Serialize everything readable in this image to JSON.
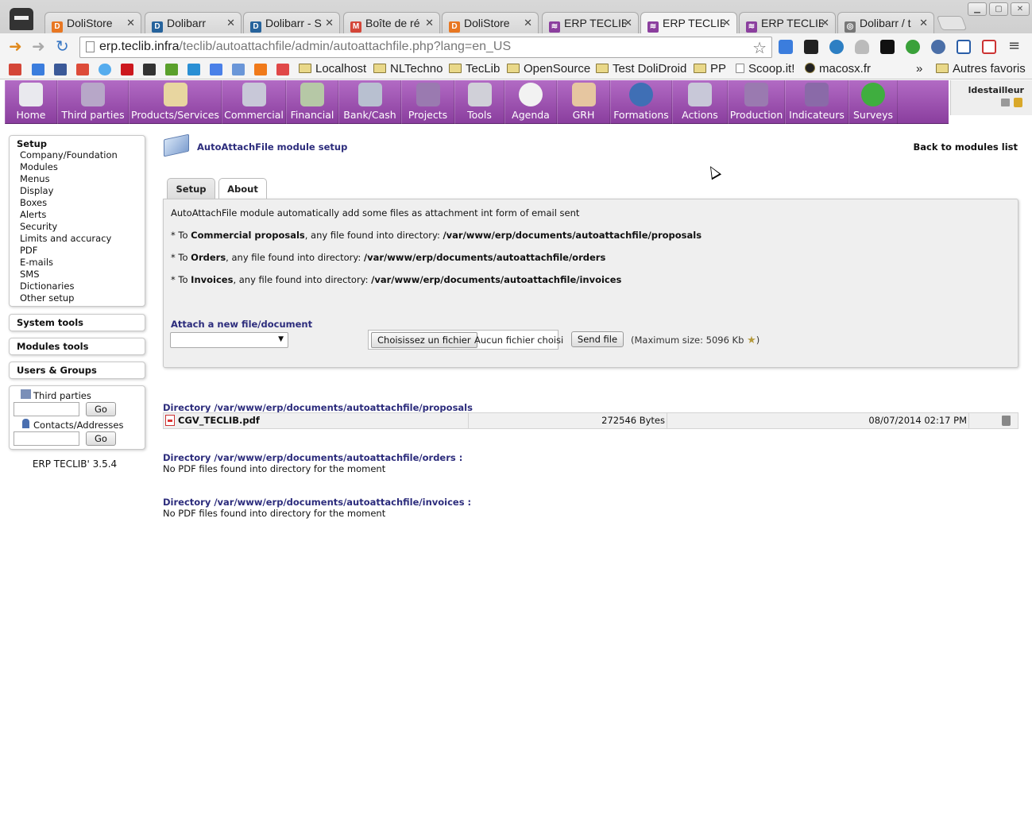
{
  "browser": {
    "tabs": [
      {
        "title": "DoliStore",
        "icon_color": "#e87722",
        "glyph": "D"
      },
      {
        "title": "Dolibarr",
        "icon_color": "#26639c",
        "glyph": "D"
      },
      {
        "title": "Dolibarr - S",
        "icon_color": "#26639c",
        "glyph": "D"
      },
      {
        "title": "Boîte de ré",
        "icon_color": "#d44638",
        "glyph": "M"
      },
      {
        "title": "DoliStore",
        "icon_color": "#e87722",
        "glyph": "D"
      },
      {
        "title": "ERP TECLIB",
        "icon_color": "#8b3f9e",
        "glyph": "≋"
      },
      {
        "title": "ERP TECLIB",
        "icon_color": "#8b3f9e",
        "glyph": "≋"
      },
      {
        "title": "ERP TECLIB",
        "icon_color": "#8b3f9e",
        "glyph": "≋"
      },
      {
        "title": "Dolibarr / t",
        "icon_color": "#777777",
        "glyph": "◎"
      }
    ],
    "active_tab_index": 6,
    "url_host": "erp.teclib.infra",
    "url_path": "/teclib/autoattachfile/admin/autoattachfile.php?lang=en_US",
    "bookmarks": [
      "Localhost",
      "NLTechno",
      "TecLib",
      "OpenSource",
      "Test DoliDroid",
      "PP",
      "Scoop.it!",
      "macosx.fr"
    ],
    "bookmarks_more": "»",
    "other_bookmarks": "Autres favoris"
  },
  "topmenu": {
    "items": [
      {
        "label": "Home",
        "color": "#e9e9ee"
      },
      {
        "label": "Third parties",
        "color": "#b7a7c8"
      },
      {
        "label": "Products/Services",
        "color": "#e8d6a0"
      },
      {
        "label": "Commercial",
        "color": "#c8c8d8"
      },
      {
        "label": "Financial",
        "color": "#b6c8a6"
      },
      {
        "label": "Bank/Cash",
        "color": "#b8c0d0"
      },
      {
        "label": "Projects",
        "color": "#9a7ab0"
      },
      {
        "label": "Tools",
        "color": "#d0d0d8"
      },
      {
        "label": "Agenda",
        "color": "#f2f2f2"
      },
      {
        "label": "GRH",
        "color": "#e6c6a0"
      },
      {
        "label": "Formations",
        "color": "#3f6fb5"
      },
      {
        "label": "Actions",
        "color": "#c8c8d8"
      },
      {
        "label": "Production",
        "color": "#9a7ab0"
      },
      {
        "label": "Indicateurs",
        "color": "#8a6aa8"
      },
      {
        "label": "Surveys",
        "color": "#3fae3f"
      }
    ],
    "login": "ldestailleur"
  },
  "sidebar": {
    "setup_title": "Setup",
    "setup_links": [
      "Company/Foundation",
      "Modules",
      "Menus",
      "Display",
      "Boxes",
      "Alerts",
      "Security",
      "Limits and accuracy",
      "PDF",
      "E-mails",
      "SMS",
      "Dictionaries",
      "Other setup"
    ],
    "system_tools": "System tools",
    "modules_tools": "Modules tools",
    "users_groups": "Users & Groups",
    "search_thirdparties": "Third parties",
    "search_contacts": "Contacts/Addresses",
    "go_label": "Go",
    "version": "ERP TECLIB' 3.5.4"
  },
  "main": {
    "title": "AutoAttachFile module setup",
    "back_link": "Back to modules list",
    "tabs": {
      "setup": "Setup",
      "about": "About"
    },
    "intro": "AutoAttachFile module automatically add some files as attachment int form of email sent",
    "rules": [
      {
        "prefix": "* To ",
        "doc": "Commercial proposals",
        "middle": ", any file found into directory: ",
        "dir": "/var/www/erp/documents/autoattachfile/proposals"
      },
      {
        "prefix": "* To ",
        "doc": "Orders",
        "middle": ", any file found into directory: ",
        "dir": "/var/www/erp/documents/autoattachfile/orders"
      },
      {
        "prefix": "* To ",
        "doc": "Invoices",
        "middle": ", any file found into directory: ",
        "dir": "/var/www/erp/documents/autoattachfile/invoices"
      }
    ],
    "attach_title": "Attach a new file/document",
    "choose_file_label": "Choisissez un fichier",
    "no_file_label": "Aucun fichier choisi",
    "send_file_label": "Send file",
    "max_size_text": "(Maximum size: 5096 Kb",
    "max_size_close": ")",
    "directories": [
      {
        "title": "Directory /var/www/erp/documents/autoattachfile/proposals"
      },
      {
        "title": "Directory /var/www/erp/documents/autoattachfile/orders :",
        "empty": "No PDF files found into directory for the moment"
      },
      {
        "title": "Directory /var/www/erp/documents/autoattachfile/invoices :",
        "empty": "No PDF files found into directory for the moment"
      }
    ],
    "file": {
      "name": "CGV_TECLIB.pdf",
      "size": "272546 Bytes",
      "date": "08/07/2014 02:17 PM"
    }
  }
}
